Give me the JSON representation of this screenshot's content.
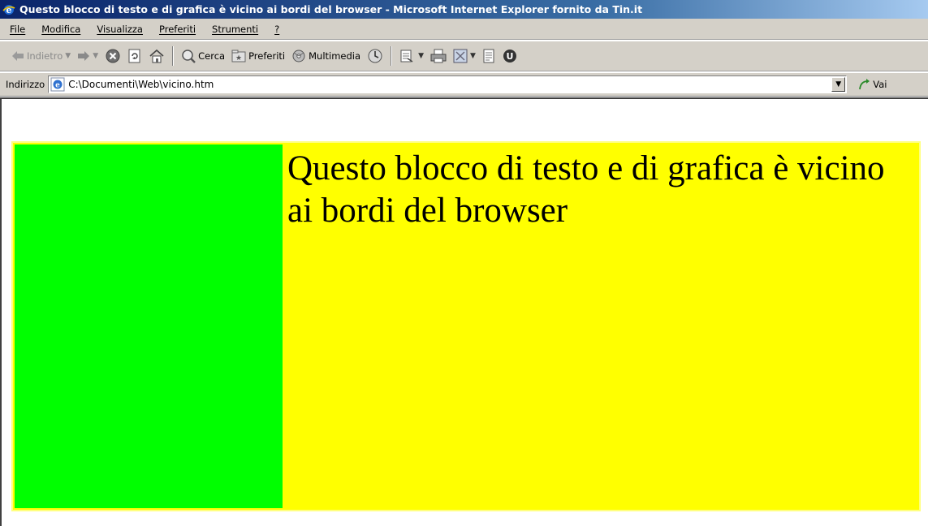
{
  "window": {
    "title": "Questo blocco di testo e di grafica è vicino ai bordi del browser - Microsoft Internet Explorer fornito da Tin.it"
  },
  "menu": {
    "items": [
      "File",
      "Modifica",
      "Visualizza",
      "Preferiti",
      "Strumenti",
      "?"
    ]
  },
  "toolbar": {
    "back_label": "Indietro",
    "search_label": "Cerca",
    "favorites_label": "Preferiti",
    "media_label": "Multimedia"
  },
  "address": {
    "label": "Indirizzo",
    "value": "C:\\Documenti\\Web\\vicino.htm",
    "go_label": "Vai"
  },
  "content": {
    "text": "Questo blocco di testo e di grafica è vicino ai bordi del browser"
  },
  "colors": {
    "left_cell": "#00ff00",
    "right_cell": "#ffff00",
    "title_bar": "#0a246a"
  }
}
